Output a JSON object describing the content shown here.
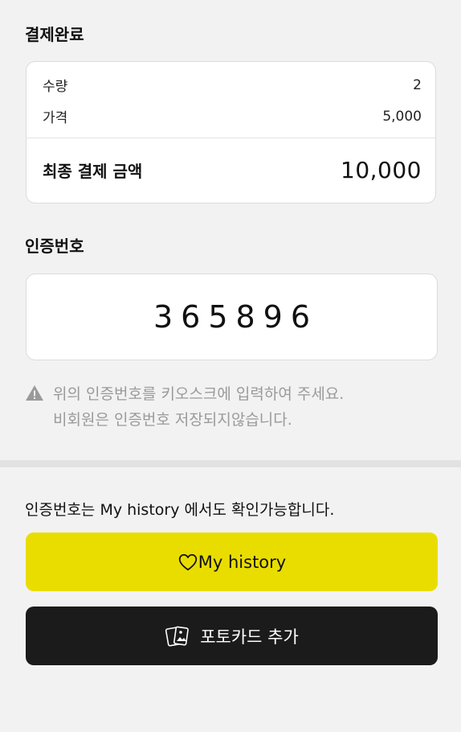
{
  "payment": {
    "title": "결제완료",
    "quantity_label": "수량",
    "quantity_value": "2",
    "price_label": "가격",
    "price_value": "5,000",
    "total_label": "최종 결제 금액",
    "total_value": "10,000"
  },
  "auth": {
    "title": "인증번호",
    "code": "365896",
    "notice_line1": "위의 인증번호를 키오스크에 입력하여 주세요.",
    "notice_line2": "비회원은 인증번호 저장되지않습니다.",
    "notice_icon": "warning-icon"
  },
  "history": {
    "info_text": "인증번호는 My history 에서도 확인가능합니다.",
    "button_label": "My history",
    "button_icon": "heart-icon",
    "button_color": "#e9dd00"
  },
  "photocard": {
    "button_label": "포토카드 추가",
    "button_icon": "photocard-icon",
    "button_color": "#1b1b1b"
  }
}
